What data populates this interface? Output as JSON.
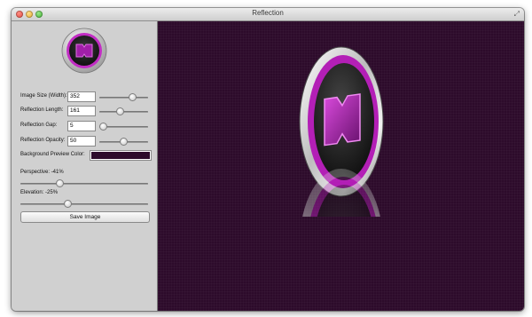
{
  "window": {
    "title": "Reflection"
  },
  "settings": {
    "image_size": {
      "label": "Image Size (Width):",
      "value": "352",
      "slider_fraction": 0.68
    },
    "reflection_length": {
      "label": "Reflection Length:",
      "value": "161",
      "slider_fraction": 0.45
    },
    "reflection_gap": {
      "label": "Reflection Gap:",
      "value": "5",
      "slider_fraction": 0.1
    },
    "reflection_opacity": {
      "label": "Reflection Opacity:",
      "value": "50",
      "slider_fraction": 0.5
    },
    "background_preview_color": {
      "label": "Background Preview Color:",
      "color": "#2d0b2b"
    },
    "perspective": {
      "label": "Perspective:",
      "value": "-41%",
      "slider_fraction": 0.3
    },
    "elevation": {
      "label": "Elevation:",
      "value": "-25%",
      "slider_fraction": 0.37
    }
  },
  "actions": {
    "save_label": "Save Image"
  },
  "preview": {
    "icon": "purple-badge-icon",
    "accent_color": "#b227b4",
    "background_color": "#2d0b2b"
  }
}
